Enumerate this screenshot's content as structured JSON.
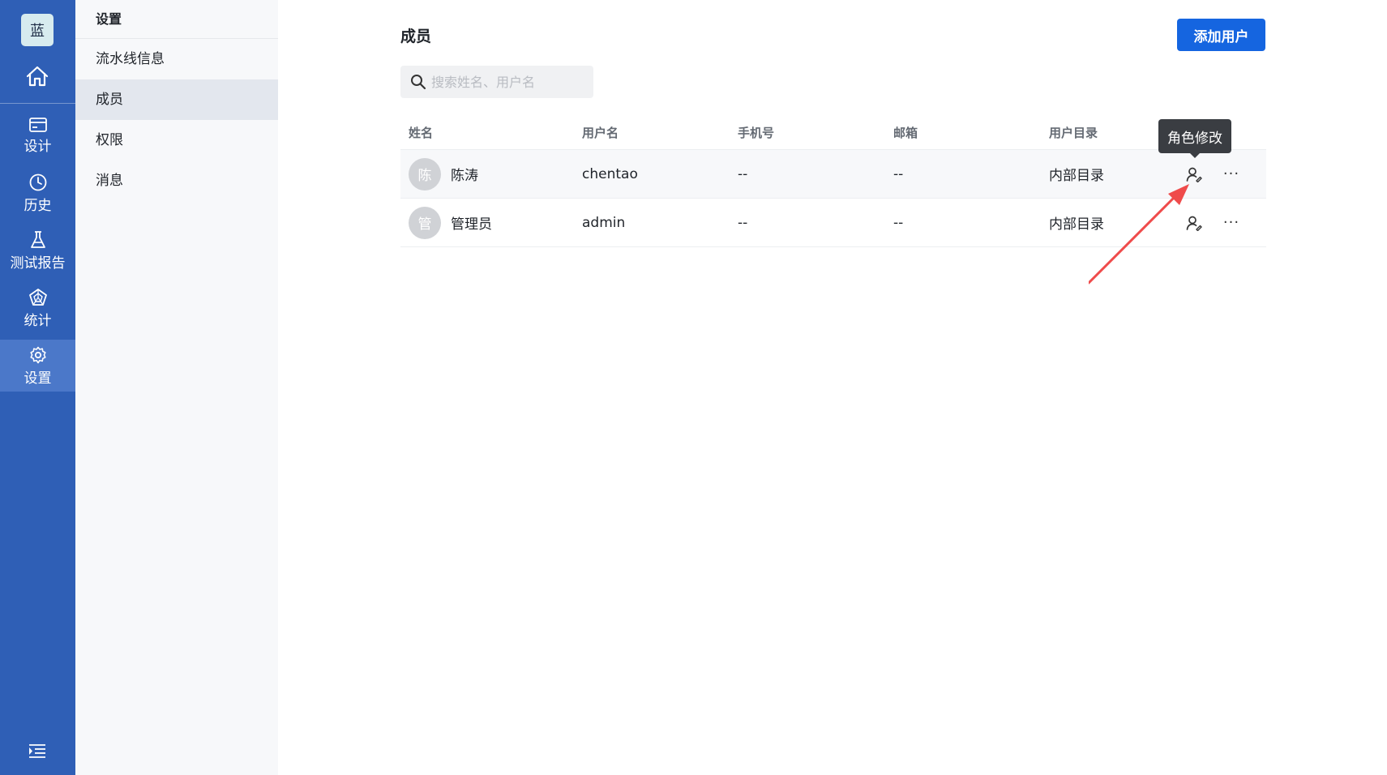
{
  "rail": {
    "logo": "蓝",
    "items": [
      {
        "label": "设计",
        "icon": "card-icon"
      },
      {
        "label": "历史",
        "icon": "clock-icon"
      },
      {
        "label": "测试报告",
        "icon": "flask-icon"
      },
      {
        "label": "统计",
        "icon": "pentagon-chart-icon"
      },
      {
        "label": "设置",
        "icon": "gear-icon",
        "active": true
      }
    ],
    "accent": "#2f5fb6"
  },
  "subnav": {
    "title": "设置",
    "items": [
      {
        "label": "流水线信息"
      },
      {
        "label": "成员",
        "active": true
      },
      {
        "label": "权限"
      },
      {
        "label": "消息"
      }
    ]
  },
  "main": {
    "title": "成员",
    "add_button": "添加用户",
    "search_placeholder": "搜索姓名、用户名",
    "columns": [
      "姓名",
      "用户名",
      "手机号",
      "邮箱",
      "用户目录"
    ],
    "rows": [
      {
        "avatar": "陈",
        "name": "陈涛",
        "username": "chentao",
        "phone": "--",
        "email": "--",
        "directory": "内部目录"
      },
      {
        "avatar": "管",
        "name": "管理员",
        "username": "admin",
        "phone": "--",
        "email": "--",
        "directory": "内部目录"
      }
    ],
    "tooltip": "角色修改",
    "more_label": "···"
  },
  "colors": {
    "primary": "#1565e0",
    "annotation_arrow": "#ef4b4b"
  }
}
